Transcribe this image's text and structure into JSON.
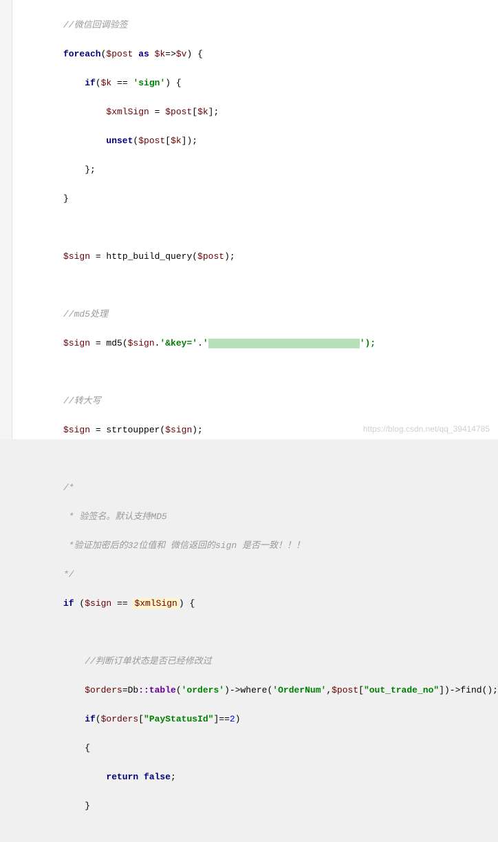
{
  "code": {
    "comment1": "//微信回调验签",
    "foreach_kw": "foreach",
    "foreach_open": "(",
    "post_var": "$post",
    "as_kw": " as ",
    "k_var": "$k",
    "arrow": "=>",
    "v_var": "$v",
    "foreach_close": ") {",
    "if_kw": "if",
    "if_open": "(",
    "k_var2": "$k",
    "eq_op": " == ",
    "sign_str": "'sign'",
    "if_close": ") {",
    "xmlsign_var": "$xmlSign",
    "assign1": " = ",
    "post_var2": "$post",
    "bracket_open": "[",
    "k_var3": "$k",
    "bracket_close": "];",
    "unset_kw": "unset",
    "unset_open": "(",
    "post_var3": "$post",
    "bracket_open2": "[",
    "k_var4": "$k",
    "bracket_close2": "]);",
    "brace_close1": "};",
    "brace_close2": "}",
    "sign_var": "$sign",
    "assign2": " = http_build_query(",
    "post_var4": "$post",
    "close_paren": ");",
    "comment2": "//md5处理",
    "sign_var2": "$sign",
    "assign3": " = md5(",
    "sign_var3": "$sign",
    "concat": ".",
    "key_str": "'&key='",
    "concat2": ".",
    "quote1": "'",
    "quote2": "');",
    "comment3": "//转大写",
    "sign_var4": "$sign",
    "assign4": " = strtoupper(",
    "sign_var5": "$sign",
    "close_paren2": ");",
    "comment_block_open": "/*",
    "comment_line1": " * 验签名。默认支持MD5",
    "comment_line2": " *验证加密后的32位值和 微信返回的sign 是否一致！！！",
    "comment_block_close": "*/",
    "if_kw2": "if",
    "if_open2": " (",
    "sign_var6": "$sign",
    "eq_op2": " == ",
    "xmlsign_var2": "$xmlSign",
    "if_close2": ") {",
    "comment4": "//判断订单状态是否已经修改过",
    "orders_var": "$orders",
    "assign5": "=Db",
    "static_op": "::",
    "table_func": "table",
    "table_open": "(",
    "orders_str": "'orders'",
    "chain1": ")->where(",
    "ordernum_str": "'OrderNum'",
    "comma": ",",
    "post_var5": "$post",
    "bracket_open3": "[",
    "tradeno_str": "\"out_trade_no\"",
    "bracket_close3": "])->find();",
    "if_kw3": "if",
    "if_open3": "(",
    "orders_var2": "$orders",
    "bracket_open4": "[",
    "paystatus_str": "\"PayStatusId\"",
    "bracket_close4": "]",
    "eq_op3": "==",
    "num2": "2",
    "if_close3": ")",
    "brace_open": "{",
    "return_kw": "return false",
    "semicolon": ";",
    "brace_close3": "}"
  },
  "watermark": "https://blog.csdn.net/qq_39414785"
}
